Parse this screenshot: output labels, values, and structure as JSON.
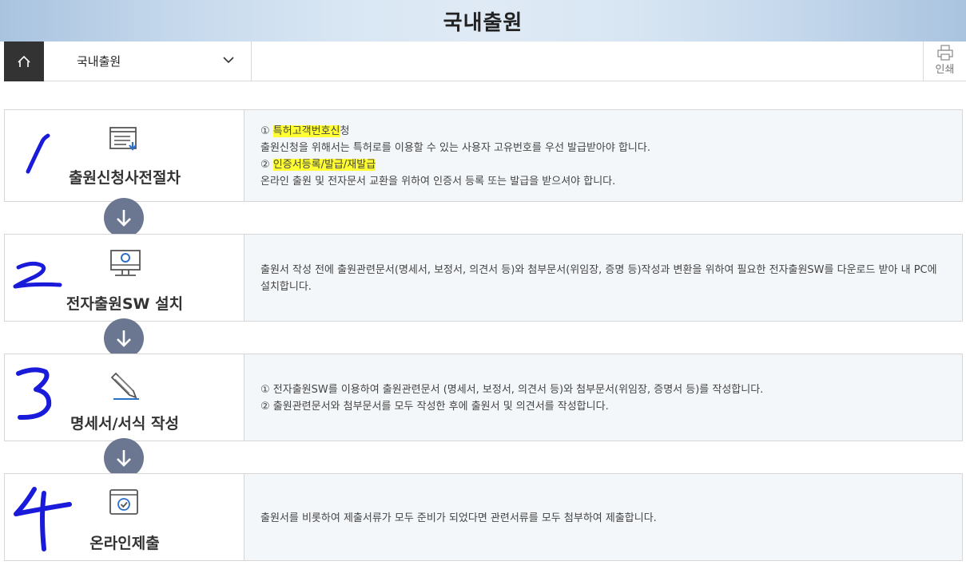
{
  "header": {
    "title": "국내출원"
  },
  "navbar": {
    "home_icon": "home-icon",
    "selected": "국내출원",
    "print_label": "인쇄"
  },
  "steps": [
    {
      "name": "출원신청사전절차",
      "icon": "document-download-icon",
      "handwritten_number": "1",
      "lines": [
        {
          "prefix": "① ",
          "highlight": "특허고객번호신",
          "suffix": "청"
        },
        {
          "text": "출원신청을 위해서는 특허로를 이용할 수 있는 사용자 고유번호를 우선 발급받아야 합니다."
        },
        {
          "prefix": "② ",
          "highlight": "인증서등록/발급/재발급",
          "suffix": ""
        },
        {
          "text": "온라인 출원 및 전자문서 교환을 위하여 인증서 등록 또는 발급을 받으셔야 합니다."
        }
      ]
    },
    {
      "name": "전자출원SW 설치",
      "icon": "computer-icon",
      "handwritten_number": "2",
      "text": "출원서 작성 전에 출원관련문서(명세서, 보정서, 의견서 등)와 첨부문서(위임장, 증명 등)작성과 변환을 위하여 필요한 전자출원SW를 다운로드 받아 내 PC에 설치합니다."
    },
    {
      "name": "명세서/서식 작성",
      "icon": "pencil-icon",
      "handwritten_number": "3",
      "lines": [
        {
          "text": "① 전자출원SW를 이용하여 출원관련문서 (명세서, 보정서, 의견서 등)와 첨부문서(위임장, 증명서 등)를 작성합니다."
        },
        {
          "text": "② 출원관련문서와 첨부문서를 모두 작성한 후에 출원서 및 의견서를 작성합니다."
        }
      ]
    },
    {
      "name": "온라인제출",
      "icon": "window-check-icon",
      "handwritten_number": "4",
      "text": "출원서를 비롯하여 제출서류가 모두 준비가 되었다면 관련서류를 모두 첨부하여 제출합니다."
    }
  ],
  "colors": {
    "arrow_circle": "#6b7791",
    "highlight": "#ffff33",
    "handwriting": "#1a1adb",
    "panel_bg": "#f4f7fa"
  }
}
